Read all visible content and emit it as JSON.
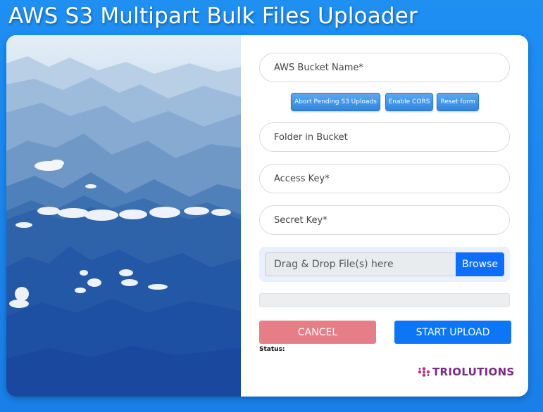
{
  "app": {
    "title": "AWS S3 Multipart Bulk Files Uploader"
  },
  "form": {
    "bucket_placeholder": "AWS Bucket Name*",
    "folder_placeholder": "Folder in Bucket",
    "access_key_placeholder": "Access Key*",
    "secret_key_placeholder": "Secret Key*",
    "buttons": {
      "abort": "Abort Pending S3 Uploads",
      "cors": "Enable CORS",
      "reset": "Reset form"
    },
    "dropzone": {
      "label": "Drag & Drop File(s) here",
      "browse": "Browse"
    },
    "progress": 0,
    "cancel": "CANCEL",
    "start": "START UPLOAD",
    "status_label": "Status:"
  },
  "brand": {
    "name": "TRIOLUTIONS",
    "color": "#7b2a84"
  },
  "colors": {
    "background": "#1f8ff2",
    "primary": "#0d6efd",
    "cancel": "#e57e87"
  },
  "icons": {
    "brand_logo": "triolutions-logo-icon"
  }
}
